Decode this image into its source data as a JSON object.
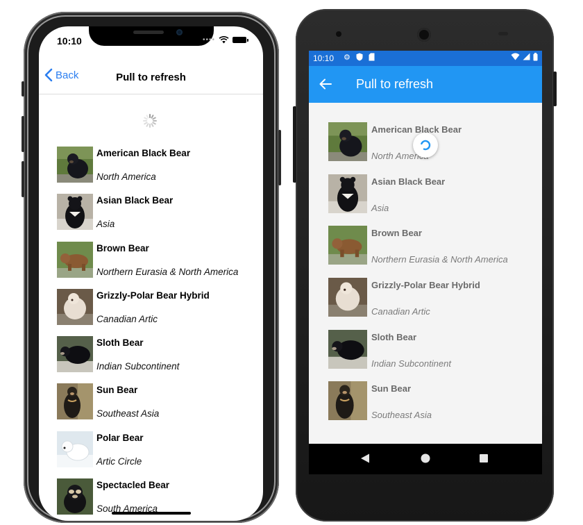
{
  "ios": {
    "status": {
      "time": "10:10"
    },
    "nav": {
      "back_label": "Back",
      "title": "Pull to refresh"
    },
    "items": [
      {
        "name": "American Black Bear",
        "location": "North America"
      },
      {
        "name": "Asian Black Bear",
        "location": "Asia"
      },
      {
        "name": "Brown Bear",
        "location": "Northern Eurasia & North America"
      },
      {
        "name": "Grizzly-Polar Bear Hybrid",
        "location": "Canadian Artic"
      },
      {
        "name": "Sloth Bear",
        "location": "Indian Subcontinent"
      },
      {
        "name": "Sun Bear",
        "location": "Southeast Asia"
      },
      {
        "name": "Polar Bear",
        "location": "Artic Circle"
      },
      {
        "name": "Spectacled Bear",
        "location": "South America"
      }
    ]
  },
  "android": {
    "status": {
      "time": "10:10"
    },
    "appbar": {
      "title": "Pull to refresh"
    },
    "items": [
      {
        "name": "American Black Bear",
        "location": "North America"
      },
      {
        "name": "Asian Black Bear",
        "location": "Asia"
      },
      {
        "name": "Brown Bear",
        "location": "Northern Eurasia & North America"
      },
      {
        "name": "Grizzly-Polar Bear Hybrid",
        "location": "Canadian Artic"
      },
      {
        "name": "Sloth Bear",
        "location": "Indian Subcontinent"
      },
      {
        "name": "Sun Bear",
        "location": "Southeast Asia"
      }
    ]
  },
  "colors": {
    "ios_accent": "#2b7ef0",
    "android_status_bar": "#1a6fd6",
    "android_app_bar": "#2196f3",
    "android_spinner": "#2196f3"
  },
  "icons": {
    "ios_back": "chevron-left-icon",
    "android_back": "arrow-left-icon",
    "android_nav": [
      "back-triangle-icon",
      "home-circle-icon",
      "recents-square-icon"
    ]
  }
}
